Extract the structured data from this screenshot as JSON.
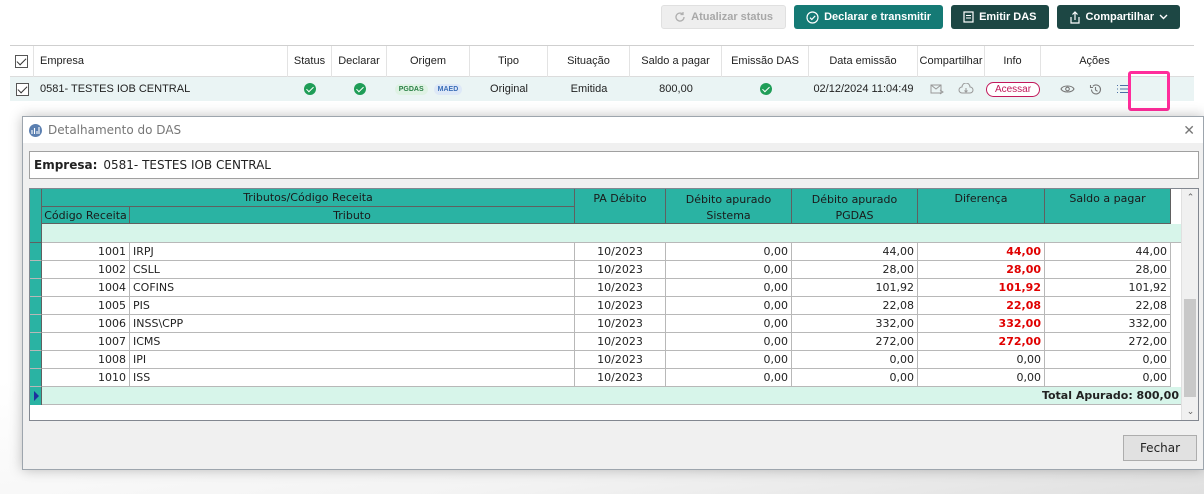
{
  "toolbar": {
    "refresh_label": "Atualizar status",
    "declare_label": "Declarar e transmitir",
    "emit_label": "Emitir DAS",
    "share_label": "Compartilhar"
  },
  "web_table": {
    "headers": {
      "empresa": "Empresa",
      "status": "Status",
      "declarar": "Declarar",
      "origem": "Origem",
      "tipo": "Tipo",
      "situacao": "Situação",
      "saldo": "Saldo a pagar",
      "emissao": "Emissão DAS",
      "data": "Data emissão",
      "compartilhar": "Compartilhar",
      "info": "Info",
      "acoes": "Ações"
    },
    "row": {
      "empresa": "0581- TESTES IOB CENTRAL",
      "tag_pgdas": "PGDAS",
      "tag_maed": "MAED",
      "tipo": "Original",
      "situacao": "Emitida",
      "saldo": "800,00",
      "data": "02/12/2024 11:04:49",
      "acessar": "Acessar"
    }
  },
  "modal": {
    "title": "Detalhamento do DAS",
    "empresa_label": "Empresa:",
    "empresa_value": "0581- TESTES IOB CENTRAL",
    "close_label": "Fechar",
    "grid_headers": {
      "group": "Tributos/Código Receita",
      "codigo": "Código Receita",
      "tributo": "Tributo",
      "pa": "PA Débito",
      "sistema_1": "Débito apurado",
      "sistema_2": "Sistema",
      "pgdas_1": "Débito apurado",
      "pgdas_2": "PGDAS",
      "diferenca": "Diferença",
      "saldo": "Saldo a pagar"
    },
    "rows": [
      {
        "codigo": "1001",
        "tributo": "IRPJ",
        "pa": "10/2023",
        "sistema": "0,00",
        "pgdas": "44,00",
        "diferenca": "44,00",
        "saldo": "44,00",
        "neg": true
      },
      {
        "codigo": "1002",
        "tributo": "CSLL",
        "pa": "10/2023",
        "sistema": "0,00",
        "pgdas": "28,00",
        "diferenca": "28,00",
        "saldo": "28,00",
        "neg": true
      },
      {
        "codigo": "1004",
        "tributo": "COFINS",
        "pa": "10/2023",
        "sistema": "0,00",
        "pgdas": "101,92",
        "diferenca": "101,92",
        "saldo": "101,92",
        "neg": true
      },
      {
        "codigo": "1005",
        "tributo": "PIS",
        "pa": "10/2023",
        "sistema": "0,00",
        "pgdas": "22,08",
        "diferenca": "22,08",
        "saldo": "22,08",
        "neg": true
      },
      {
        "codigo": "1006",
        "tributo": "INSS\\CPP",
        "pa": "10/2023",
        "sistema": "0,00",
        "pgdas": "332,00",
        "diferenca": "332,00",
        "saldo": "332,00",
        "neg": true
      },
      {
        "codigo": "1007",
        "tributo": "ICMS",
        "pa": "10/2023",
        "sistema": "0,00",
        "pgdas": "272,00",
        "diferenca": "272,00",
        "saldo": "272,00",
        "neg": true
      },
      {
        "codigo": "1008",
        "tributo": "IPI",
        "pa": "10/2023",
        "sistema": "0,00",
        "pgdas": "0,00",
        "diferenca": "0,00",
        "saldo": "0,00",
        "neg": false
      },
      {
        "codigo": "1010",
        "tributo": "ISS",
        "pa": "10/2023",
        "sistema": "0,00",
        "pgdas": "0,00",
        "diferenca": "0,00",
        "saldo": "0,00",
        "neg": false
      }
    ],
    "total_label": "Total Apurado: 800,00"
  },
  "colors": {
    "header_teal": "#2ab3a3",
    "band_mint": "#d7f5ea",
    "diff_red": "#e00000",
    "highlight_pink": "#ff2c9b",
    "button_teal": "#157a75",
    "button_dark": "#1d4744"
  }
}
